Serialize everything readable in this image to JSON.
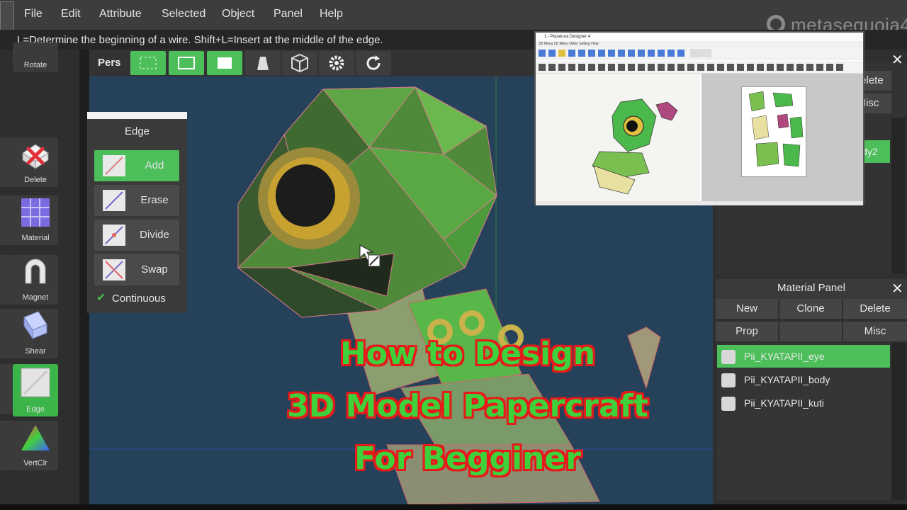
{
  "menu": {
    "items": [
      "File",
      "Edit",
      "Attribute",
      "Selected",
      "Object",
      "Panel",
      "Help"
    ],
    "logo": "metasequoia4"
  },
  "hint": "L=Determine the beginning of a wire.  Shift+L=Insert at the middle of the edge.",
  "tools": {
    "rotate": "Rotate",
    "delete": "Delete",
    "material": "Material",
    "magnet": "Magnet",
    "shear": "Shear",
    "edge": "Edge",
    "vertclr": "VertClr"
  },
  "viewbar": {
    "pers": "Pers"
  },
  "edge_panel": {
    "title": "Edge",
    "buttons": [
      "Add",
      "Erase",
      "Divide",
      "Swap"
    ],
    "continuous": "Continuous"
  },
  "upper_panel": {
    "buttons": [
      "Delete",
      "Misc"
    ],
    "selected_item": "dy2",
    "fragment": "e"
  },
  "material_panel": {
    "title": "Material Panel",
    "buttons_row1": [
      "New",
      "Clone",
      "Delete"
    ],
    "buttons_row2": [
      "Prop",
      "",
      "Misc"
    ],
    "materials": [
      "Pii_KYATAPII_eye",
      "Pii_KYATAPII_body",
      "Pii_KYATAPII_kuti"
    ],
    "selected_index": 0
  },
  "inset": {
    "window_title": "1 - Pepakura Designer 4",
    "menu": "3D Menu   2D Menu   Other   Setting   Help"
  },
  "overlay": {
    "line1": "How to Design",
    "line2": "3D Model Papercraft",
    "line3": "For Begginer"
  },
  "colors": {
    "accent_green": "#4cbf5a",
    "title_green": "#3fd13b",
    "title_outline": "#e51b1b",
    "viewport_blue": "#26415a"
  }
}
